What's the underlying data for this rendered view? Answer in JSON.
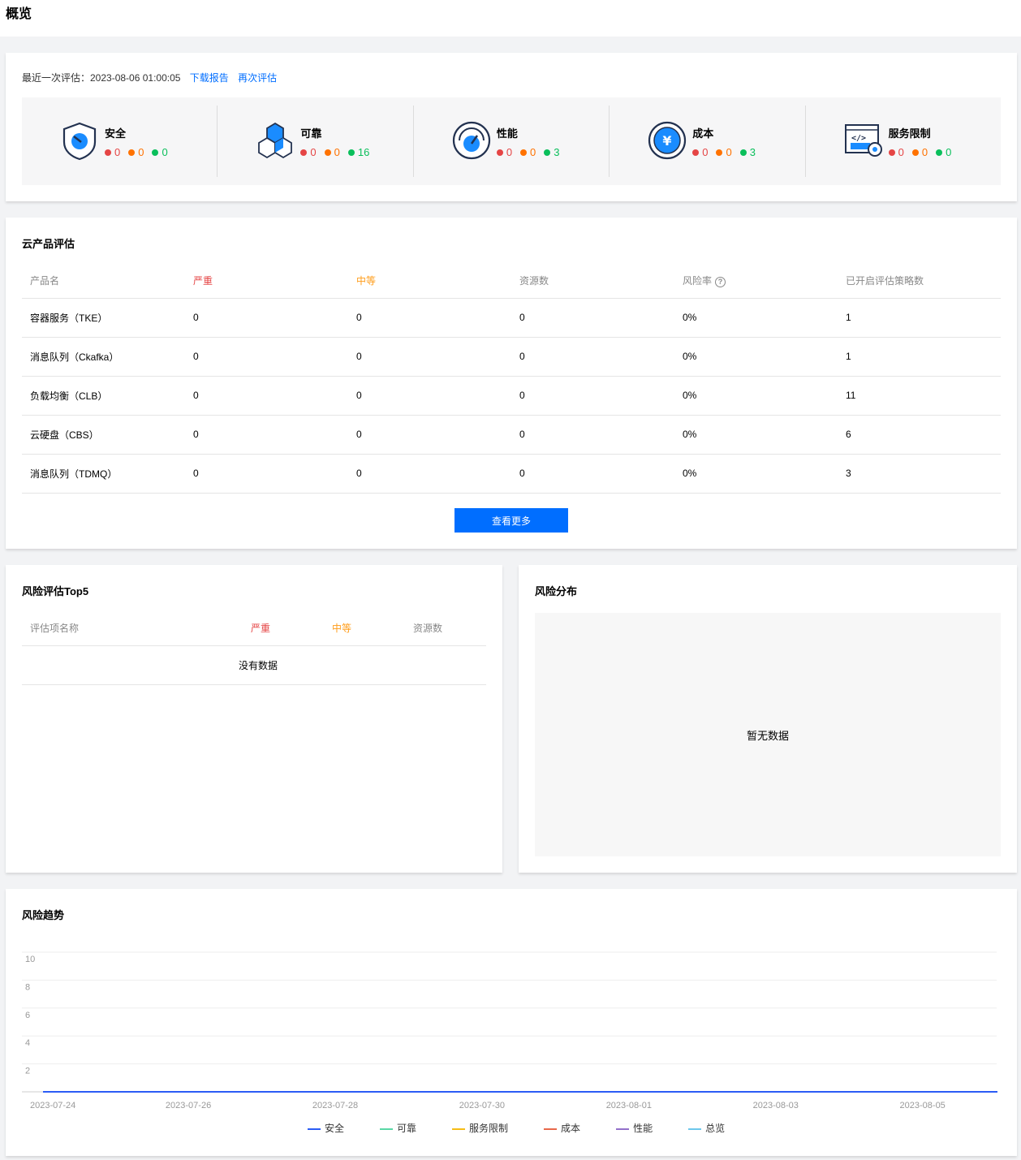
{
  "page_title": "概览",
  "overview": {
    "last_eval_label": "最近一次评估：2023-08-06 01:00:05",
    "download_link": "下载报告",
    "reeval_link": "再次评估",
    "pillars": [
      {
        "name": "安全",
        "icon": "shield-icon",
        "high": "0",
        "mid": "0",
        "low": "0"
      },
      {
        "name": "可靠",
        "icon": "cubes-icon",
        "high": "0",
        "mid": "0",
        "low": "16"
      },
      {
        "name": "性能",
        "icon": "gauge-icon",
        "high": "0",
        "mid": "0",
        "low": "3"
      },
      {
        "name": "成本",
        "icon": "yen-icon",
        "high": "0",
        "mid": "0",
        "low": "3"
      },
      {
        "name": "服务限制",
        "icon": "code-settings-icon",
        "high": "0",
        "mid": "0",
        "low": "0"
      }
    ]
  },
  "products": {
    "title": "云产品评估",
    "headers": [
      "产品名",
      "严重",
      "中等",
      "资源数",
      "风险率",
      "已开启评估策略数"
    ],
    "rows": [
      [
        "容器服务（TKE）",
        "0",
        "0",
        "0",
        "0%",
        "1"
      ],
      [
        "消息队列（Ckafka）",
        "0",
        "0",
        "0",
        "0%",
        "1"
      ],
      [
        "负载均衡（CLB）",
        "0",
        "0",
        "0",
        "0%",
        "11"
      ],
      [
        "云硬盘（CBS）",
        "0",
        "0",
        "0",
        "0%",
        "6"
      ],
      [
        "消息队列（TDMQ）",
        "0",
        "0",
        "0",
        "0%",
        "3"
      ]
    ],
    "more_button": "查看更多"
  },
  "top5": {
    "title": "风险评估Top5",
    "headers": [
      "评估项名称",
      "严重",
      "中等",
      "资源数"
    ],
    "empty_text": "没有数据"
  },
  "distribution": {
    "title": "风险分布",
    "empty_text": "暂无数据"
  },
  "trend": {
    "title": "风险趋势"
  },
  "chart_data": {
    "type": "line",
    "x": [
      "2023-07-24",
      "2023-07-25",
      "2023-07-26",
      "2023-07-27",
      "2023-07-28",
      "2023-07-29",
      "2023-07-30",
      "2023-07-31",
      "2023-08-01",
      "2023-08-02",
      "2023-08-03",
      "2023-08-04",
      "2023-08-05",
      "2023-08-06"
    ],
    "x_tick_labels": [
      "2023-07-24",
      "2023-07-26",
      "2023-07-28",
      "2023-07-30",
      "2023-08-01",
      "2023-08-03",
      "2023-08-05"
    ],
    "y_ticks": [
      2,
      4,
      6,
      8,
      10
    ],
    "ylim": [
      0,
      10
    ],
    "grid": true,
    "legend_position": "bottom",
    "series": [
      {
        "name": "安全",
        "color": "#2b5cf5",
        "values": [
          0,
          0,
          0,
          0,
          0,
          0,
          0,
          0,
          0,
          0,
          0,
          0,
          0,
          0
        ]
      },
      {
        "name": "可靠",
        "color": "#5ad8a6",
        "values": [
          0,
          0,
          0,
          0,
          0,
          0,
          0,
          0,
          0,
          0,
          0,
          0,
          0,
          0
        ]
      },
      {
        "name": "服务限制",
        "color": "#f6bd16",
        "values": [
          0,
          0,
          0,
          0,
          0,
          0,
          0,
          0,
          0,
          0,
          0,
          0,
          0,
          0
        ]
      },
      {
        "name": "成本",
        "color": "#e8684a",
        "values": [
          0,
          0,
          0,
          0,
          0,
          0,
          0,
          0,
          0,
          0,
          0,
          0,
          0,
          0
        ]
      },
      {
        "name": "性能",
        "color": "#9270ca",
        "values": [
          0,
          0,
          0,
          0,
          0,
          0,
          0,
          0,
          0,
          0,
          0,
          0,
          0,
          0
        ]
      },
      {
        "name": "总览",
        "color": "#6dc8ec",
        "values": [
          0,
          0,
          0,
          0,
          0,
          0,
          0,
          0,
          0,
          0,
          0,
          0,
          0,
          0
        ]
      }
    ]
  }
}
